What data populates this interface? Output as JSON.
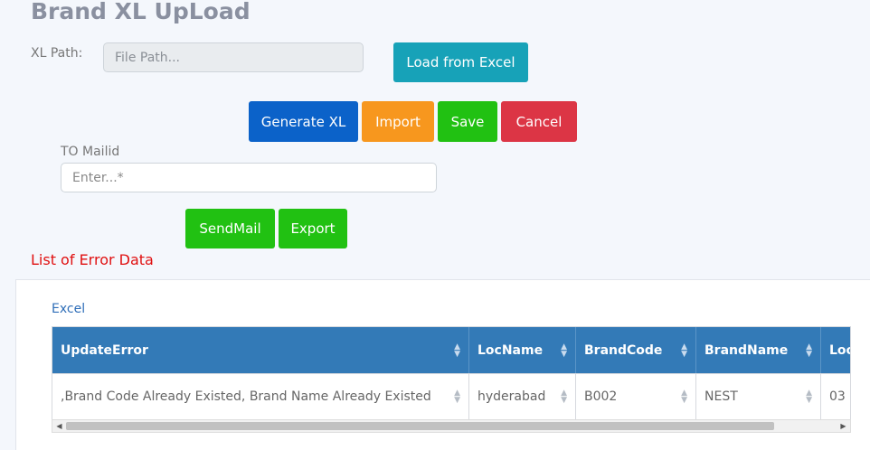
{
  "page": {
    "title": "Brand XL UpLoad"
  },
  "upload": {
    "label": "XL Path:",
    "file_placeholder": "File Path...",
    "load_button": "Load from Excel"
  },
  "actions": {
    "generate": "Generate XL",
    "import": "Import",
    "save": "Save",
    "cancel": "Cancel"
  },
  "mail": {
    "label": "TO Mailid",
    "placeholder": "Enter...*",
    "sendmail": "SendMail",
    "export": "Export"
  },
  "errors": {
    "heading": "List of Error Data",
    "excel_link": "Excel",
    "columns": [
      "UpdateError",
      "LocName",
      "BrandCode",
      "BrandName",
      "Loc"
    ],
    "rows": [
      [
        ",Brand Code Already Existed, Brand Name Already Existed",
        "hyderabad",
        "B002",
        "NEST",
        "03"
      ]
    ]
  },
  "colors": {
    "primary": "#0b62c9",
    "info": "#17a2b8",
    "warning": "#f7971e",
    "success": "#21c112",
    "danger": "#dc3545",
    "grid_header": "#337ab7",
    "error_text": "#e01010"
  }
}
